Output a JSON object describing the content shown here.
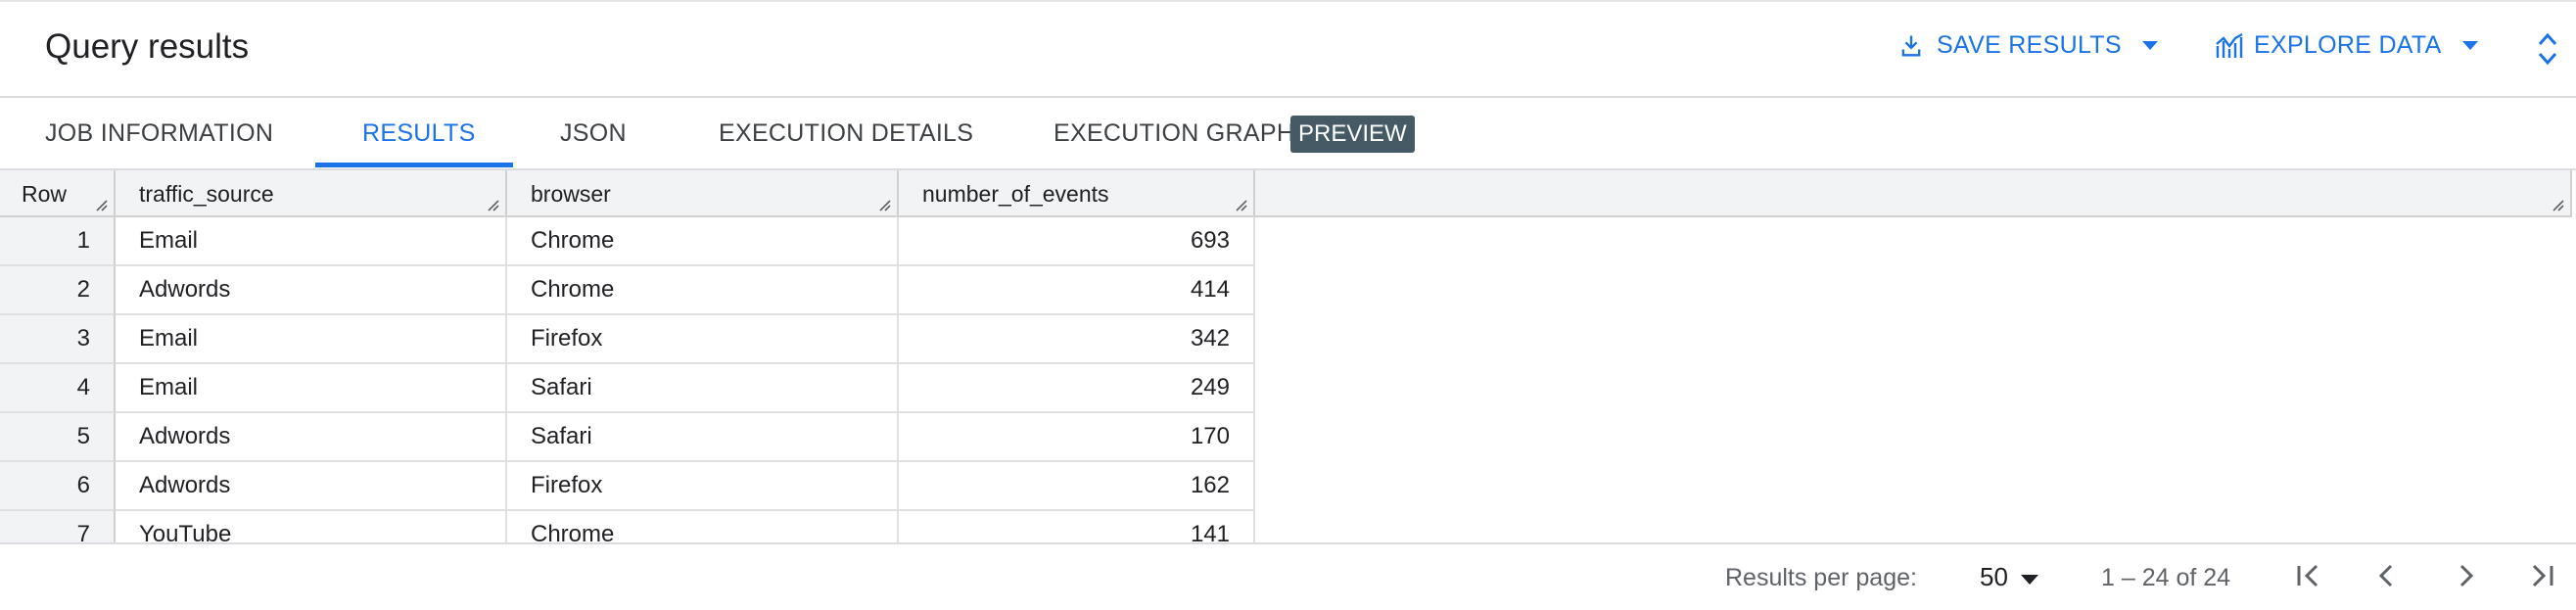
{
  "header": {
    "title": "Query results",
    "save_label": "SAVE RESULTS",
    "explore_label": "EXPLORE DATA",
    "accent": "#1a73e8"
  },
  "tabs": [
    {
      "label": "JOB INFORMATION",
      "active": false
    },
    {
      "label": "RESULTS",
      "active": true
    },
    {
      "label": "JSON",
      "active": false
    },
    {
      "label": "EXECUTION DETAILS",
      "active": false
    },
    {
      "label": "EXECUTION GRAPH",
      "active": false
    }
  ],
  "preview_badge": "PREVIEW",
  "table": {
    "columns": [
      "Row",
      "traffic_source",
      "browser",
      "number_of_events"
    ],
    "rows": [
      {
        "row": "1",
        "traffic_source": "Email",
        "browser": "Chrome",
        "number_of_events": "693"
      },
      {
        "row": "2",
        "traffic_source": "Adwords",
        "browser": "Chrome",
        "number_of_events": "414"
      },
      {
        "row": "3",
        "traffic_source": "Email",
        "browser": "Firefox",
        "number_of_events": "342"
      },
      {
        "row": "4",
        "traffic_source": "Email",
        "browser": "Safari",
        "number_of_events": "249"
      },
      {
        "row": "5",
        "traffic_source": "Adwords",
        "browser": "Safari",
        "number_of_events": "170"
      },
      {
        "row": "6",
        "traffic_source": "Adwords",
        "browser": "Firefox",
        "number_of_events": "162"
      },
      {
        "row": "7",
        "traffic_source": "YouTube",
        "browser": "Chrome",
        "number_of_events": "141"
      }
    ]
  },
  "footer": {
    "results_per_page_label": "Results per page:",
    "per_page_value": "50",
    "range_text": "1 – 24 of 24"
  },
  "icons": [
    "download-icon",
    "caret-down-icon",
    "chart-icon",
    "expand-collapse-icon",
    "resize-handle-icon",
    "first-page-icon",
    "prev-page-icon",
    "next-page-icon",
    "last-page-icon"
  ]
}
